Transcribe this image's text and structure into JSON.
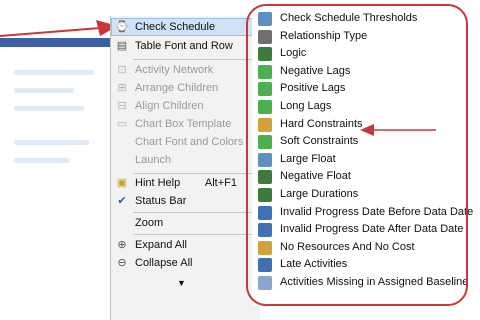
{
  "menu": {
    "items": [
      {
        "label": "Check Schedule",
        "icon": "check-schedule-icon",
        "state": "selected"
      },
      {
        "label": "Table Font and Row",
        "icon": "table-font-icon",
        "state": "normal"
      },
      {
        "label": "Activity Network",
        "icon": "activity-network-icon",
        "state": "disabled"
      },
      {
        "label": "Arrange Children",
        "icon": "arrange-children-icon",
        "state": "disabled"
      },
      {
        "label": "Align Children",
        "icon": "align-children-icon",
        "state": "disabled"
      },
      {
        "label": "Chart Box Template",
        "icon": "chart-box-template-icon",
        "state": "disabled"
      },
      {
        "label": "Chart Font and Colors",
        "icon": "chart-font-colors-icon",
        "state": "disabled"
      },
      {
        "label": "Launch",
        "icon": "launch-icon",
        "state": "disabled"
      },
      {
        "label": "Hint Help",
        "shortcut": "Alt+F1",
        "icon": "hint-help-icon",
        "state": "normal"
      },
      {
        "label": "Status Bar",
        "icon": "checkmark-icon",
        "state": "checked"
      },
      {
        "label": "Zoom",
        "icon": "zoom-icon",
        "state": "normal"
      },
      {
        "label": "Expand All",
        "icon": "expand-all-icon",
        "state": "normal"
      },
      {
        "label": "Collapse All",
        "icon": "collapse-all-icon",
        "state": "normal"
      }
    ],
    "more_indicator": "▼"
  },
  "submenu": {
    "items": [
      {
        "label": "Check Schedule Thresholds",
        "icon": "thresholds-icon",
        "color": "#5d8fbf"
      },
      {
        "label": "Relationship Type",
        "icon": "relationship-type-icon",
        "color": "#6e6e6e"
      },
      {
        "label": "Logic",
        "icon": "logic-icon",
        "color": "#3d7a3d"
      },
      {
        "label": "Negative Lags",
        "icon": "negative-lags-icon",
        "color": "#4caf50"
      },
      {
        "label": "Positive Lags",
        "icon": "positive-lags-icon",
        "color": "#4caf50"
      },
      {
        "label": "Long Lags",
        "icon": "long-lags-icon",
        "color": "#4caf50"
      },
      {
        "label": "Hard Constraints",
        "icon": "hard-constraints-icon",
        "color": "#d4a23a"
      },
      {
        "label": "Soft Constraints",
        "icon": "soft-constraints-icon",
        "color": "#4caf50"
      },
      {
        "label": "Large Float",
        "icon": "large-float-icon",
        "color": "#5d8fbf"
      },
      {
        "label": "Negative Float",
        "icon": "negative-float-icon",
        "color": "#3d7a3d"
      },
      {
        "label": "Large Durations",
        "icon": "large-durations-icon",
        "color": "#3d7a3d"
      },
      {
        "label": "Invalid Progress Date Before Data Date",
        "icon": "invalid-before-icon",
        "color": "#3f72b5"
      },
      {
        "label": "Invalid Progress Date After Data Date",
        "icon": "invalid-after-icon",
        "color": "#3f72b5"
      },
      {
        "label": "No Resources And No Cost",
        "icon": "no-resources-icon",
        "color": "#d4a23a"
      },
      {
        "label": "Late Activities",
        "icon": "late-activities-icon",
        "color": "#3f72b5"
      },
      {
        "label": "Activities Missing in Assigned Baseline",
        "icon": "missing-baseline-icon",
        "color": "#8aa8cc"
      }
    ]
  },
  "colors": {
    "highlight_ring": "#c8373b",
    "arrow": "#c8373b",
    "selected_bg": "#cfe2f6"
  }
}
